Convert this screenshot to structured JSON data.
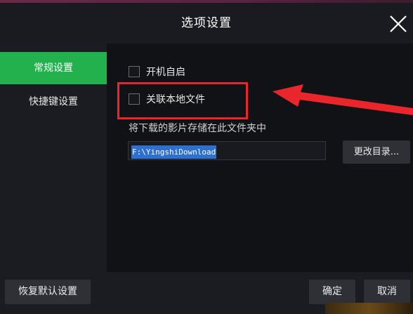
{
  "dialog": {
    "title": "选项设置"
  },
  "sidebar": {
    "items": [
      {
        "label": "常规设置",
        "active": true
      },
      {
        "label": "快捷键设置",
        "active": false
      }
    ]
  },
  "general": {
    "autostart_label": "开机自启",
    "autostart_checked": false,
    "associate_label": "关联本地文件",
    "associate_checked": false,
    "save_location_label": "将下载的影片存储在此文件夹中",
    "download_path": "F:\\YingshiDownload",
    "change_dir_label": "更改目录..."
  },
  "footer": {
    "reset_label": "恢复默认设置",
    "ok_label": "确定",
    "cancel_label": "取消"
  },
  "annotation": {
    "highlight_color": "#e8262b"
  },
  "colors": {
    "accent": "#22b14c",
    "selection": "#2f6fcf"
  }
}
